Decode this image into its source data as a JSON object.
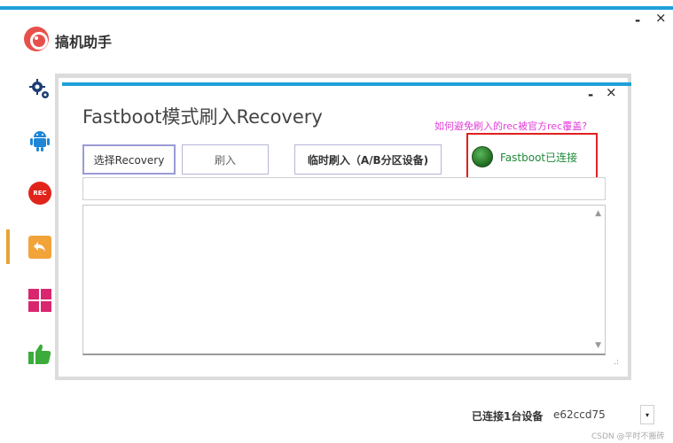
{
  "app": {
    "title": "搞机助手",
    "window_min": "-",
    "window_close": "×"
  },
  "sidebar": {
    "items": [
      {
        "name": "settings",
        "icon": "gear-icon"
      },
      {
        "name": "android",
        "icon": "android-icon"
      },
      {
        "name": "rec",
        "icon": "rec-icon",
        "badge": "REC"
      },
      {
        "name": "flash",
        "icon": "back-arrow-icon",
        "active": true
      },
      {
        "name": "apps",
        "icon": "grid-icon"
      },
      {
        "name": "like",
        "icon": "thumbs-up-icon"
      }
    ]
  },
  "panel": {
    "title": "Fastboot模式刷入Recovery",
    "min": "-",
    "close": "×",
    "help_link": "如何避免刷入的rec被官方rec覆盖?",
    "buttons": {
      "select": "选择Recovery",
      "flash": "刷入",
      "temp_flash": "临时刷入（A/B分区设备)"
    },
    "status": {
      "text": "Fastboot已连接",
      "color": "#1e8b3a",
      "led": "green"
    },
    "scroll_up": "▲",
    "scroll_down": "▼",
    "resize_grip": ".:"
  },
  "footer": {
    "connected_label": "已连接1台设备",
    "device_id": "e62ccd75",
    "dropdown_arrow": "▾"
  },
  "watermark": "CSDN @平时不搬砖",
  "colors": {
    "accent": "#1ea1d8",
    "help_link": "#e23cd8",
    "status_box": "#e02020",
    "active_bar": "#e7a43a"
  }
}
